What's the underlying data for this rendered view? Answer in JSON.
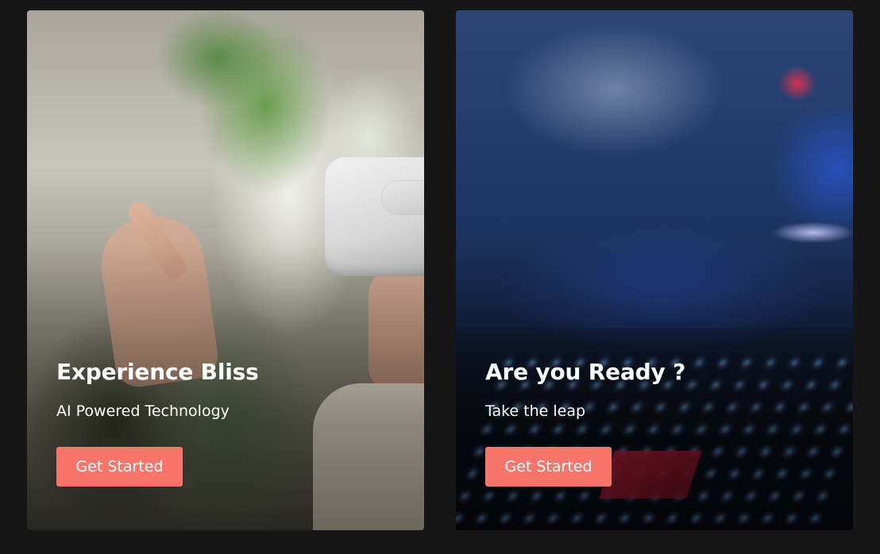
{
  "cards": [
    {
      "title": "Experience Bliss",
      "subtitle": "AI Powered Technology",
      "button_label": "Get Started"
    },
    {
      "title": "Are you Ready ?",
      "subtitle": "Take the leap",
      "button_label": "Get Started"
    }
  ],
  "colors": {
    "page_background": "#161616",
    "button_background": "#f7756a",
    "text": "#ffffff"
  }
}
